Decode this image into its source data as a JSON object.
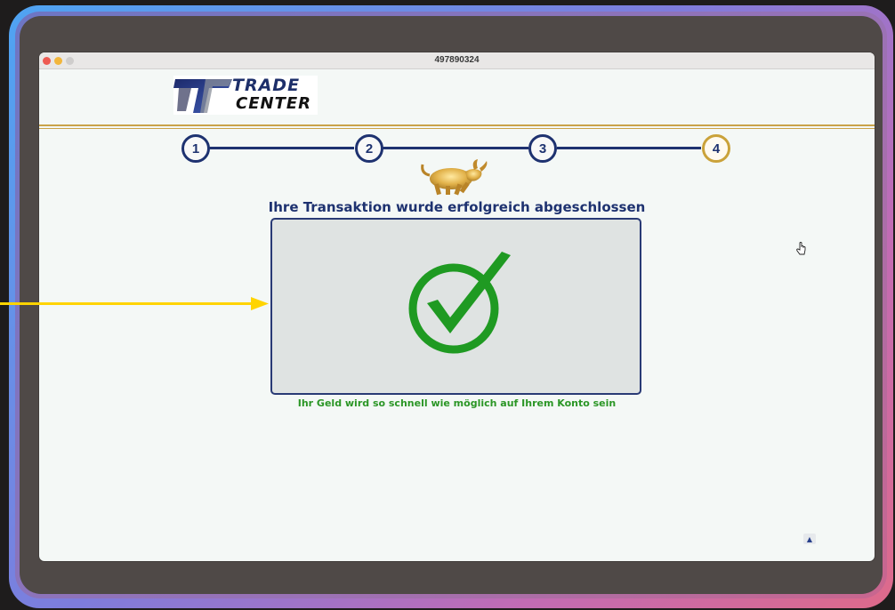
{
  "window": {
    "title": "497890324"
  },
  "logo": {
    "line1": "TRADE",
    "line2": "CENTER"
  },
  "steps": [
    {
      "label": "1",
      "state": "done"
    },
    {
      "label": "2",
      "state": "done"
    },
    {
      "label": "3",
      "state": "done"
    },
    {
      "label": "4",
      "state": "active"
    }
  ],
  "confirmation": {
    "headline": "Ihre Transaktion wurde erfolgreich abgeschlossen",
    "message": "Ihr Geld wird so schnell wie möglich auf Ihrem Konto sein"
  },
  "colors": {
    "navy": "#1e3270",
    "gold": "#caa23a",
    "success_green": "#2b9626",
    "arrow_yellow": "#ffd400"
  },
  "icons": {
    "success": "check-circle-icon",
    "mascot": "golden-bull-icon",
    "cursor": "hand-pointer-icon",
    "scroll": "arrow-up-icon",
    "annotation": "arrow-right-icon"
  }
}
